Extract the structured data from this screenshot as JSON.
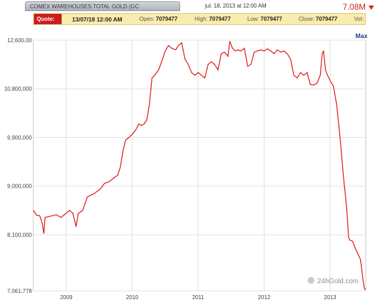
{
  "header": {
    "title": "COMEX WAREHOUSES TOTAL GOLD (GC",
    "datetime": "jul. 18, 2013 at 12:00 AM",
    "last_value": "7.08M"
  },
  "quote": {
    "label": "Quote:",
    "date": "13/07/18  12:00 AM",
    "open_label": "Open:",
    "open": "7079477",
    "high_label": "High:",
    "high": "7079477",
    "low_label": "Low:",
    "low": "7079477",
    "close_label": "Close:",
    "close": "7079477",
    "vol_label": "Vol:",
    "vol": ""
  },
  "range_button": "Max",
  "watermark": "24hGold.com",
  "colors": {
    "line": "#dd1111",
    "grid": "#e2e2e2",
    "accent": "#cc1d1d"
  },
  "chart_data": {
    "type": "line",
    "title": "COMEX WAREHOUSES TOTAL GOLD (GC",
    "xlabel": "",
    "ylabel": "",
    "ylim": [
      7061778,
      11700000
    ],
    "xlim": [
      2008.5,
      2013.54
    ],
    "y_ticks": [
      7061778,
      8100000,
      9000000,
      9900000,
      10800000,
      11700000
    ],
    "y_tick_labels": [
      "7,061,778",
      "8,100,000",
      "9,000,000",
      "9,900,000",
      "10,800,000",
      "12,600,00"
    ],
    "x_ticks": [
      2009,
      2010,
      2011,
      2012,
      2013
    ],
    "x_tick_labels": [
      "2009",
      "2010",
      "2011",
      "2012",
      "2013"
    ],
    "grid": true,
    "series": [
      {
        "values": [
          [
            2008.5,
            8550000
          ],
          [
            2008.52,
            8520000
          ],
          [
            2008.55,
            8460000
          ],
          [
            2008.6,
            8450000
          ],
          [
            2008.64,
            8300000
          ],
          [
            2008.66,
            8120000
          ],
          [
            2008.68,
            8420000
          ],
          [
            2008.75,
            8440000
          ],
          [
            2008.85,
            8470000
          ],
          [
            2008.92,
            8420000
          ],
          [
            2008.97,
            8470000
          ],
          [
            2009.05,
            8550000
          ],
          [
            2009.1,
            8500000
          ],
          [
            2009.15,
            8250000
          ],
          [
            2009.18,
            8490000
          ],
          [
            2009.25,
            8550000
          ],
          [
            2009.32,
            8800000
          ],
          [
            2009.42,
            8860000
          ],
          [
            2009.52,
            8950000
          ],
          [
            2009.58,
            9050000
          ],
          [
            2009.65,
            9080000
          ],
          [
            2009.72,
            9150000
          ],
          [
            2009.78,
            9200000
          ],
          [
            2009.82,
            9350000
          ],
          [
            2009.86,
            9650000
          ],
          [
            2009.9,
            9850000
          ],
          [
            2009.95,
            9900000
          ],
          [
            2010.0,
            9960000
          ],
          [
            2010.05,
            10030000
          ],
          [
            2010.1,
            10150000
          ],
          [
            2010.14,
            10120000
          ],
          [
            2010.18,
            10150000
          ],
          [
            2010.22,
            10220000
          ],
          [
            2010.26,
            10500000
          ],
          [
            2010.3,
            11000000
          ],
          [
            2010.34,
            11050000
          ],
          [
            2010.4,
            11150000
          ],
          [
            2010.46,
            11350000
          ],
          [
            2010.5,
            11500000
          ],
          [
            2010.55,
            11600000
          ],
          [
            2010.6,
            11550000
          ],
          [
            2010.66,
            11520000
          ],
          [
            2010.7,
            11600000
          ],
          [
            2010.75,
            11650000
          ],
          [
            2010.8,
            11350000
          ],
          [
            2010.85,
            11250000
          ],
          [
            2010.9,
            11100000
          ],
          [
            2010.95,
            11050000
          ],
          [
            2011.0,
            11100000
          ],
          [
            2011.05,
            11050000
          ],
          [
            2011.1,
            11000000
          ],
          [
            2011.15,
            11250000
          ],
          [
            2011.2,
            11300000
          ],
          [
            2011.25,
            11250000
          ],
          [
            2011.3,
            11150000
          ],
          [
            2011.35,
            11450000
          ],
          [
            2011.4,
            11480000
          ],
          [
            2011.45,
            11400000
          ],
          [
            2011.48,
            11680000
          ],
          [
            2011.52,
            11550000
          ],
          [
            2011.56,
            11500000
          ],
          [
            2011.6,
            11520000
          ],
          [
            2011.65,
            11500000
          ],
          [
            2011.7,
            11550000
          ],
          [
            2011.75,
            11220000
          ],
          [
            2011.8,
            11250000
          ],
          [
            2011.85,
            11480000
          ],
          [
            2011.9,
            11500000
          ],
          [
            2011.95,
            11520000
          ],
          [
            2012.0,
            11500000
          ],
          [
            2012.05,
            11540000
          ],
          [
            2012.1,
            11500000
          ],
          [
            2012.15,
            11450000
          ],
          [
            2012.2,
            11520000
          ],
          [
            2012.25,
            11480000
          ],
          [
            2012.3,
            11500000
          ],
          [
            2012.35,
            11450000
          ],
          [
            2012.4,
            11350000
          ],
          [
            2012.45,
            11050000
          ],
          [
            2012.5,
            11000000
          ],
          [
            2012.55,
            11100000
          ],
          [
            2012.6,
            11050000
          ],
          [
            2012.65,
            11100000
          ],
          [
            2012.7,
            10880000
          ],
          [
            2012.75,
            10870000
          ],
          [
            2012.8,
            10900000
          ],
          [
            2012.85,
            11050000
          ],
          [
            2012.88,
            11450000
          ],
          [
            2012.9,
            11500000
          ],
          [
            2012.93,
            11150000
          ],
          [
            2012.96,
            11050000
          ],
          [
            2013.0,
            10950000
          ],
          [
            2013.05,
            10850000
          ],
          [
            2013.1,
            10500000
          ],
          [
            2013.15,
            9900000
          ],
          [
            2013.2,
            9200000
          ],
          [
            2013.25,
            8600000
          ],
          [
            2013.28,
            8050000
          ],
          [
            2013.3,
            8000000
          ],
          [
            2013.34,
            7980000
          ],
          [
            2013.38,
            7850000
          ],
          [
            2013.42,
            7750000
          ],
          [
            2013.46,
            7640000
          ],
          [
            2013.5,
            7250000
          ],
          [
            2013.52,
            7100000
          ],
          [
            2013.54,
            7079477
          ]
        ]
      }
    ]
  }
}
